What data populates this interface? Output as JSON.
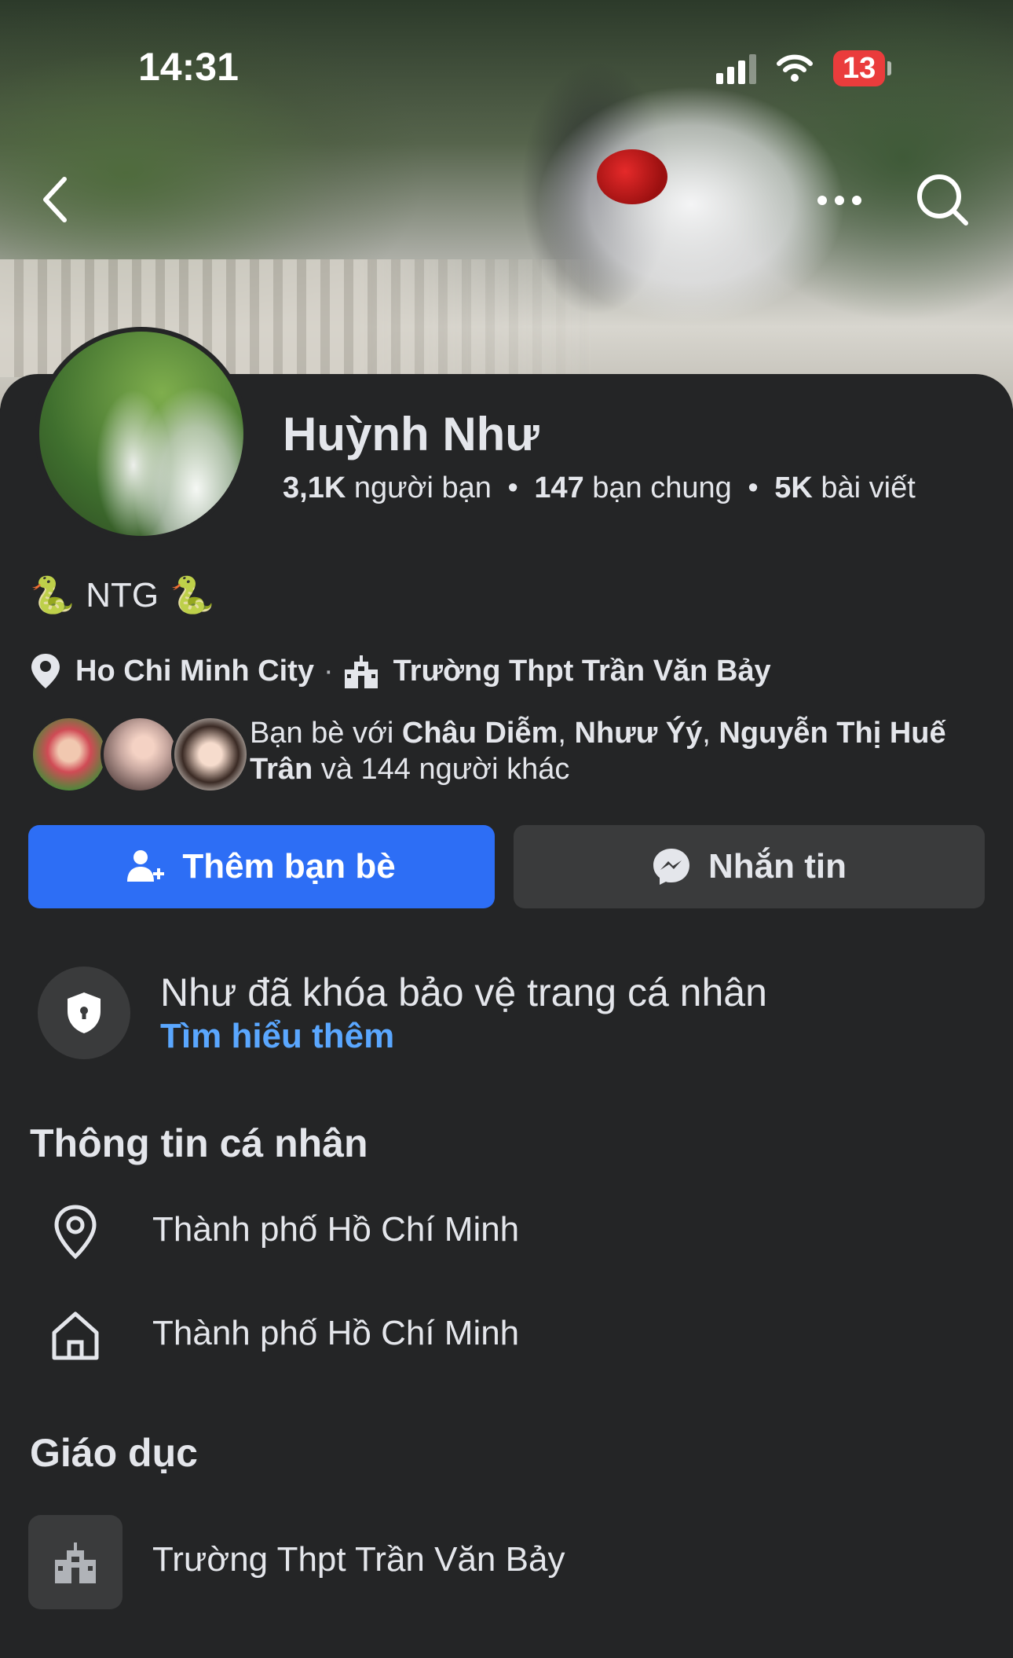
{
  "status_bar": {
    "time": "14:31",
    "battery": "13"
  },
  "profile": {
    "name": "Huỳnh Như",
    "stats": {
      "friends_count": "3,1K",
      "friends_label": "người bạn",
      "mutual_count": "147",
      "mutual_label": "bạn chung",
      "posts_count": "5K",
      "posts_label": "bài viết",
      "dot": "•"
    },
    "bio": {
      "emoji": "🐍",
      "text": "NTG"
    },
    "location": "Ho Chi Minh City",
    "separator": "·",
    "school": "Trường Thpt Trần Văn Bảy",
    "mutual_friends": {
      "prefix": "Bạn bè với",
      "name1": "Châu Diễm",
      "name2": "Nhưư Ýý",
      "name3": "Nguyễn Thị Huế Trân",
      "comma": ",",
      "suffix": "và 144 người khác"
    }
  },
  "actions": {
    "add_friend": "Thêm bạn bè",
    "message": "Nhắn tin"
  },
  "lock_notice": {
    "title": "Như đã khóa bảo vệ trang cá nhân",
    "link": "Tìm hiểu thêm"
  },
  "personal_info": {
    "title": "Thông tin cá nhân",
    "current_city": "Thành phố Hồ Chí Minh",
    "hometown": "Thành phố Hồ Chí Minh"
  },
  "education": {
    "title": "Giáo dục",
    "school": "Trường Thpt Trần Văn Bảy"
  },
  "colors": {
    "primary_button": "#2d6ef5",
    "link": "#5aa7ff",
    "background": "#242526",
    "surface": "#3a3b3c"
  }
}
